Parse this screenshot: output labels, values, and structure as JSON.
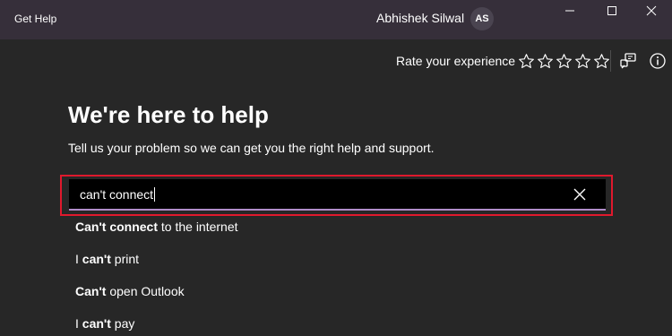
{
  "window": {
    "app_title": "Get Help",
    "user_name": "Abhishek Silwal",
    "avatar_initials": "AS"
  },
  "rating": {
    "label": "Rate your experience",
    "max_stars": 5,
    "selected_stars": 0
  },
  "main": {
    "title": "We're here to help",
    "subtitle": "Tell us your problem so we can get you the right help and support."
  },
  "search": {
    "value": "can't connect"
  },
  "suggestions": [
    {
      "bold": "Can't connect",
      "rest": " to the internet",
      "prefix": ""
    },
    {
      "prefix": "I ",
      "bold": "can't",
      "rest": " print"
    },
    {
      "prefix": "",
      "bold": "Can't",
      "rest": " open Outlook"
    },
    {
      "prefix": "I ",
      "bold": "can't",
      "rest": " pay"
    }
  ],
  "colors": {
    "titlebar": "#362f3a",
    "background": "#272727",
    "highlight": "#e0192d",
    "input_underline": "#b08dc9"
  },
  "icons": [
    "minimize-icon",
    "maximize-icon",
    "close-icon",
    "star-outline-icon",
    "feedback-icon",
    "info-icon",
    "clear-icon"
  ]
}
